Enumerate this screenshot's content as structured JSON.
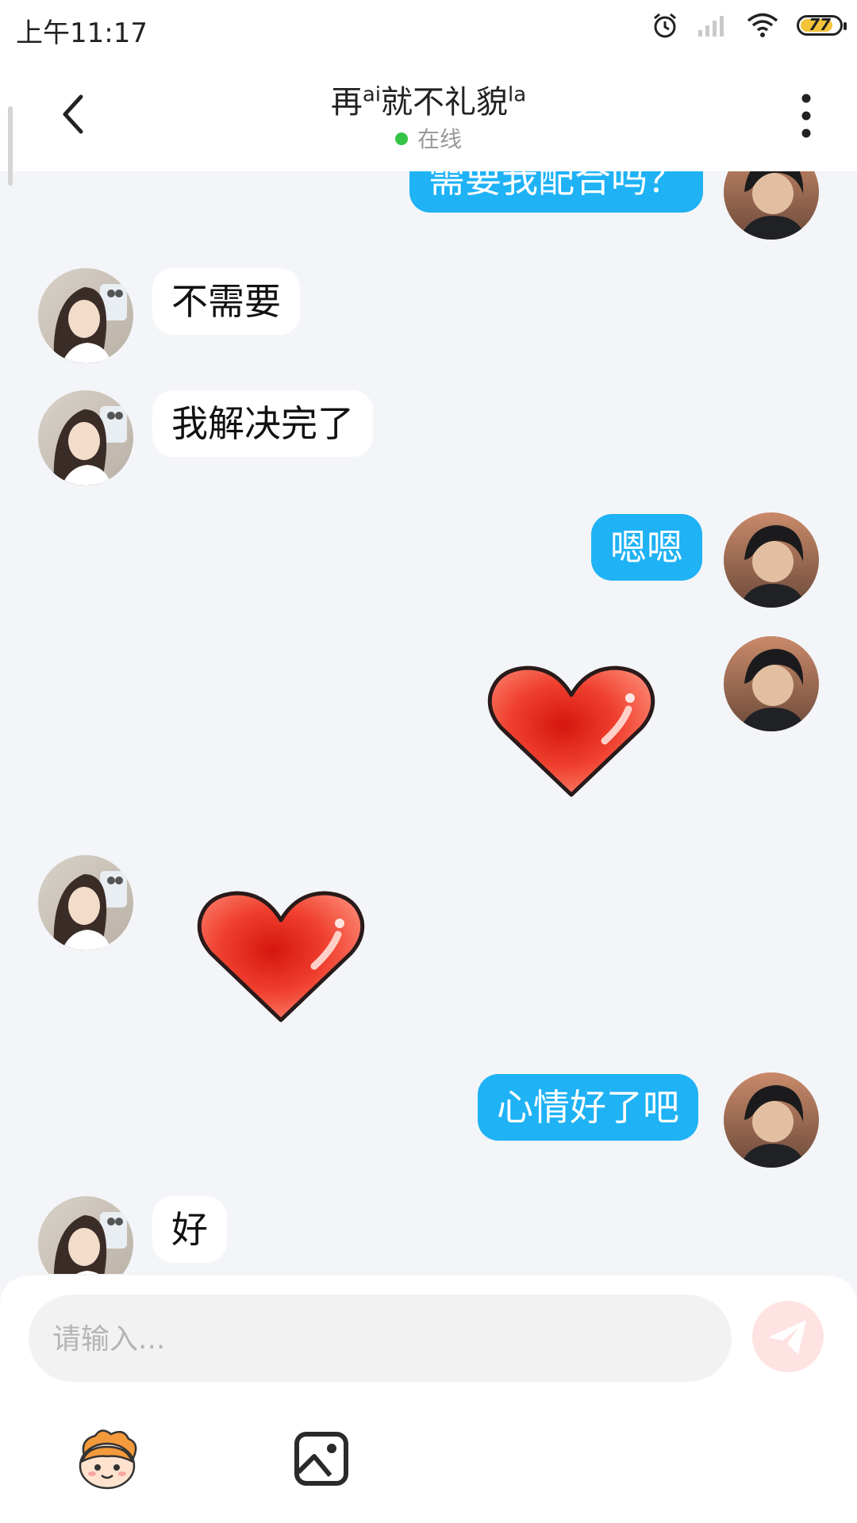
{
  "status_bar": {
    "time": "上午11:17",
    "battery": "77"
  },
  "header": {
    "title_main": "再",
    "title_sup1": "ai",
    "title_mid": "就不礼貌",
    "title_sup2": "la",
    "status": "在线"
  },
  "messages": [
    {
      "side": "out",
      "text": "需要我配合吗？"
    },
    {
      "side": "in",
      "text": "不需要"
    },
    {
      "side": "in",
      "text": "我解决完了"
    },
    {
      "side": "out",
      "text": "嗯嗯"
    },
    {
      "side": "out",
      "type": "sticker",
      "sticker": "red-heart"
    },
    {
      "side": "in",
      "type": "sticker",
      "sticker": "red-heart"
    },
    {
      "side": "out",
      "text": "心情好了吧"
    },
    {
      "side": "in",
      "text": "好"
    }
  ],
  "composer": {
    "placeholder": "请输入..."
  },
  "colors": {
    "outgoing_bubble": "#1fb2f5",
    "incoming_bubble": "#ffffff",
    "online": "#35c447",
    "send_button": "#ffe2e2"
  },
  "icons": [
    "back-icon",
    "more-icon",
    "alarm-icon",
    "signal-icon",
    "wifi-icon",
    "battery-icon",
    "send-icon",
    "emoji-icon",
    "image-icon"
  ]
}
